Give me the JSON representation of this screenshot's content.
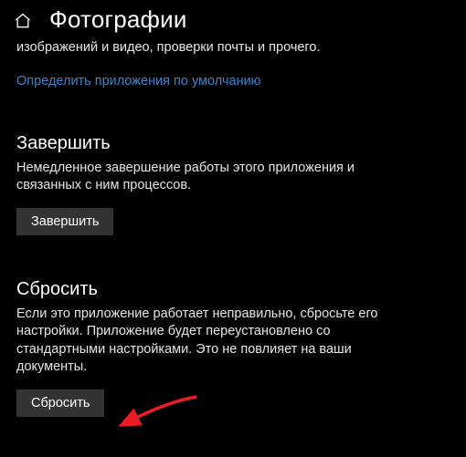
{
  "header": {
    "title": "Фотографии"
  },
  "top": {
    "truncated_line": "изображений и видео, проверки почты и прочего.",
    "link": "Определить приложения по умолчанию"
  },
  "terminate": {
    "title": "Завершить",
    "desc": "Немедленное завершение работы этого приложения и связанных с ним процессов.",
    "button": "Завершить"
  },
  "reset": {
    "title": "Сбросить",
    "desc": "Если это приложение работает неправильно, сбросьте его настройки. Приложение будет переустановлено со стандартными настройками. Это не повлияет на ваши документы.",
    "button": "Сбросить"
  },
  "annotation": {
    "arrow_color": "#ed1c24"
  }
}
